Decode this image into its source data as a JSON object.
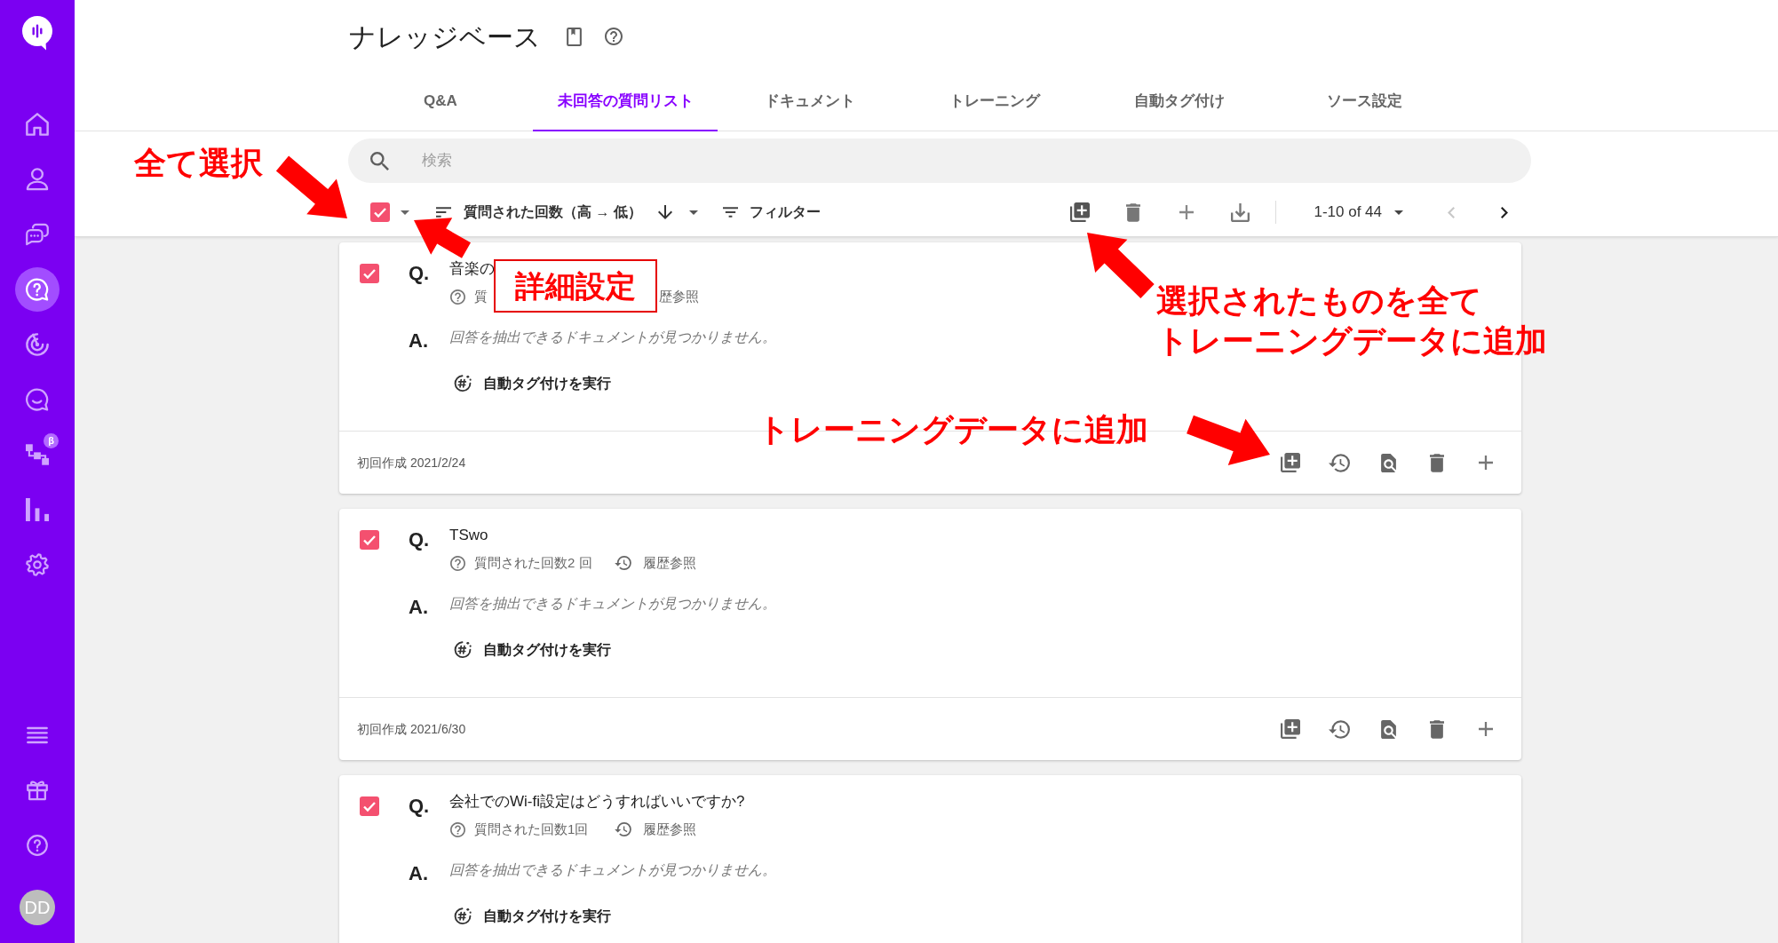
{
  "sidebar": {
    "nav": [
      {
        "selected": false
      },
      {
        "selected": false
      },
      {
        "selected": false
      },
      {
        "selected": true
      },
      {
        "selected": false
      },
      {
        "selected": false
      },
      {
        "selected": false,
        "badge": "β"
      },
      {
        "selected": false
      },
      {
        "selected": false
      }
    ],
    "avatar": "DD"
  },
  "header": {
    "title": "ナレッジベース"
  },
  "tabs": [
    {
      "label": "Q&A",
      "selected": false
    },
    {
      "label": "未回答の質問リスト",
      "selected": true
    },
    {
      "label": "ドキュメント",
      "selected": false
    },
    {
      "label": "トレーニング",
      "selected": false
    },
    {
      "label": "自動タグ付け",
      "selected": false
    },
    {
      "label": "ソース設定",
      "selected": false
    }
  ],
  "search": {
    "placeholder": "検索"
  },
  "toolbar": {
    "select_all_checked": true,
    "sort": "質問された回数（高 → 低）",
    "filter": "フィルター",
    "pagination": "1-10 of 44",
    "prev_disabled": true,
    "next_disabled": false
  },
  "questions": [
    {
      "checked": true,
      "q_label": "Q.",
      "question": "音楽の",
      "count": "質",
      "history": {
        "text": "歴参照",
        "icon": false
      },
      "a_label": "A.",
      "answer": "回答を抽出できるドキュメントが見つかりません。",
      "auto_tag": "自動タグ付けを実行",
      "created": "初回作成 2021/2/24"
    },
    {
      "checked": true,
      "q_label": "Q.",
      "question": "TSwo",
      "count": "質問された回数2 回",
      "history": {
        "text": "履歴参照",
        "icon": true
      },
      "a_label": "A.",
      "answer": "回答を抽出できるドキュメントが見つかりません。",
      "auto_tag": "自動タグ付けを実行",
      "created": "初回作成 2021/6/30"
    },
    {
      "checked": true,
      "q_label": "Q.",
      "question": "会社でのWi-fi設定はどうすればいいですか?",
      "count": "質問された回数1回",
      "history": {
        "text": "履歴参照",
        "icon": true
      },
      "a_label": "A.",
      "answer": "回答を抽出できるドキュメントが見つかりません。",
      "auto_tag": "自動タグ付けを実行"
    }
  ],
  "annotations": [
    {
      "kind": "label",
      "lines": [
        "全て選択"
      ]
    },
    {
      "kind": "boxed",
      "lines": [
        "詳細設定"
      ]
    },
    {
      "kind": "label",
      "lines": [
        "選択されたものを全て",
        "トレーニングデータに追加"
      ]
    },
    {
      "kind": "label",
      "lines": [
        "トレーニングデータに追加"
      ]
    }
  ]
}
